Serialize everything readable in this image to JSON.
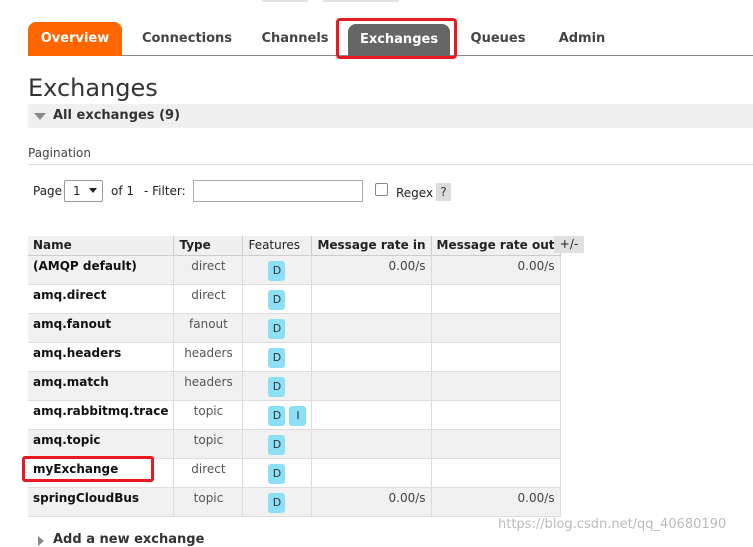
{
  "nav": {
    "tabs": [
      {
        "label": "Overview",
        "state": "orange"
      },
      {
        "label": "Connections"
      },
      {
        "label": "Channels"
      },
      {
        "label": "Exchanges",
        "state": "selected"
      },
      {
        "label": "Queues"
      },
      {
        "label": "Admin"
      }
    ]
  },
  "page": {
    "title": "Exchanges"
  },
  "section": {
    "label": "All exchanges (9)"
  },
  "pagination": {
    "label": "Pagination",
    "page_label": "Page",
    "page_value": "1",
    "of_label": "of 1",
    "filter_label": "- Filter:",
    "filter_value": "",
    "regex_label": "Regex",
    "regex_checked": false,
    "help_label": "?"
  },
  "table": {
    "columns": [
      "Name",
      "Type",
      "Features",
      "Message rate in",
      "Message rate out"
    ],
    "toggle_columns_label": "+/-",
    "rows": [
      {
        "name": "(AMQP default)",
        "type": "direct",
        "features": [
          "D"
        ],
        "rate_in": "0.00/s",
        "rate_out": "0.00/s"
      },
      {
        "name": "amq.direct",
        "type": "direct",
        "features": [
          "D"
        ],
        "rate_in": "",
        "rate_out": ""
      },
      {
        "name": "amq.fanout",
        "type": "fanout",
        "features": [
          "D"
        ],
        "rate_in": "",
        "rate_out": ""
      },
      {
        "name": "amq.headers",
        "type": "headers",
        "features": [
          "D"
        ],
        "rate_in": "",
        "rate_out": ""
      },
      {
        "name": "amq.match",
        "type": "headers",
        "features": [
          "D"
        ],
        "rate_in": "",
        "rate_out": ""
      },
      {
        "name": "amq.rabbitmq.trace",
        "type": "topic",
        "features": [
          "D",
          "I"
        ],
        "rate_in": "",
        "rate_out": ""
      },
      {
        "name": "amq.topic",
        "type": "topic",
        "features": [
          "D"
        ],
        "rate_in": "",
        "rate_out": ""
      },
      {
        "name": "myExchange",
        "type": "direct",
        "features": [
          "D"
        ],
        "rate_in": "",
        "rate_out": ""
      },
      {
        "name": "springCloudBus",
        "type": "topic",
        "features": [
          "D"
        ],
        "rate_in": "0.00/s",
        "rate_out": "0.00/s"
      }
    ]
  },
  "add_section": {
    "label": "Add a new exchange"
  },
  "watermark": "https://blog.csdn.net/qq_40680190",
  "colors": {
    "accent": "#ff6600",
    "selected_tab": "#666666",
    "badge": "#8ce0f5",
    "highlight": "#e8191f"
  }
}
